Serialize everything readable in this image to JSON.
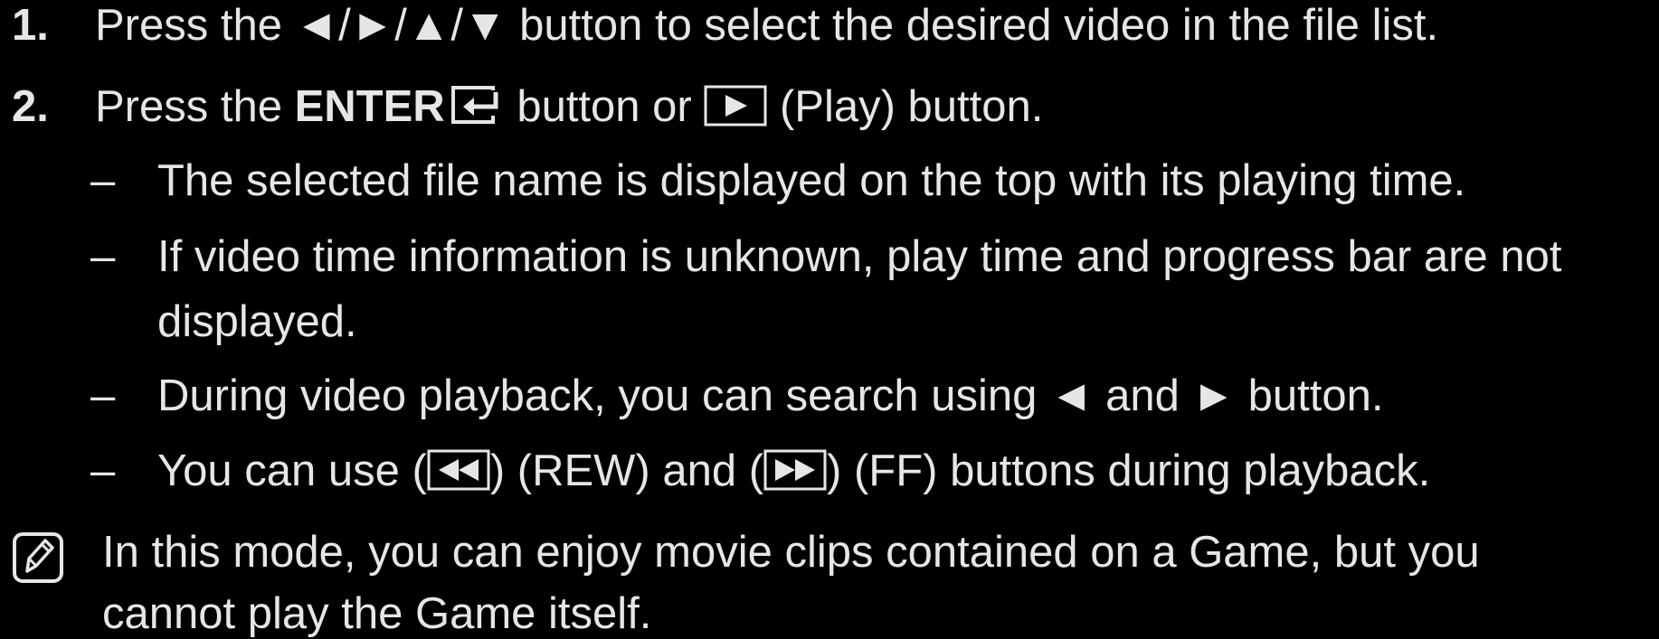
{
  "steps": [
    {
      "number": "1.",
      "text_before": "Press the",
      "arrows": [
        "◄",
        "►",
        "▲",
        "▼"
      ],
      "separator": "/",
      "text_after": "button to select the desired video in the file list."
    },
    {
      "number": "2.",
      "text_before": "Press the",
      "enter_label": "ENTER",
      "enter_icon": "enter-key-icon",
      "text_middle": "button or",
      "play_icon": "play-button-icon",
      "text_after": "(Play) button."
    }
  ],
  "notes": {
    "dash": "–",
    "note1": "The selected file name is displayed on the top with its playing time.",
    "note2_line1": "If video time information is unknown, play time and progress bar are not",
    "note2_line2": "displayed.",
    "note3_before": "During video playback, you can search using",
    "note3_left_arrow": "◄",
    "note3_and": "and",
    "note3_right_arrow": "►",
    "note3_after": "button.",
    "note4_before": "You can use (",
    "note4_rew_icon": "rewind-button-icon",
    "note4_mid": ") (REW) and (",
    "note4_ff_icon": "fast-forward-button-icon",
    "note4_after": ") (FF) buttons during playback."
  },
  "footnote": {
    "icon": "note-pencil-icon",
    "line1": "In this mode, you can enjoy movie clips contained on a Game, but you",
    "line2": "cannot play the Game itself."
  }
}
